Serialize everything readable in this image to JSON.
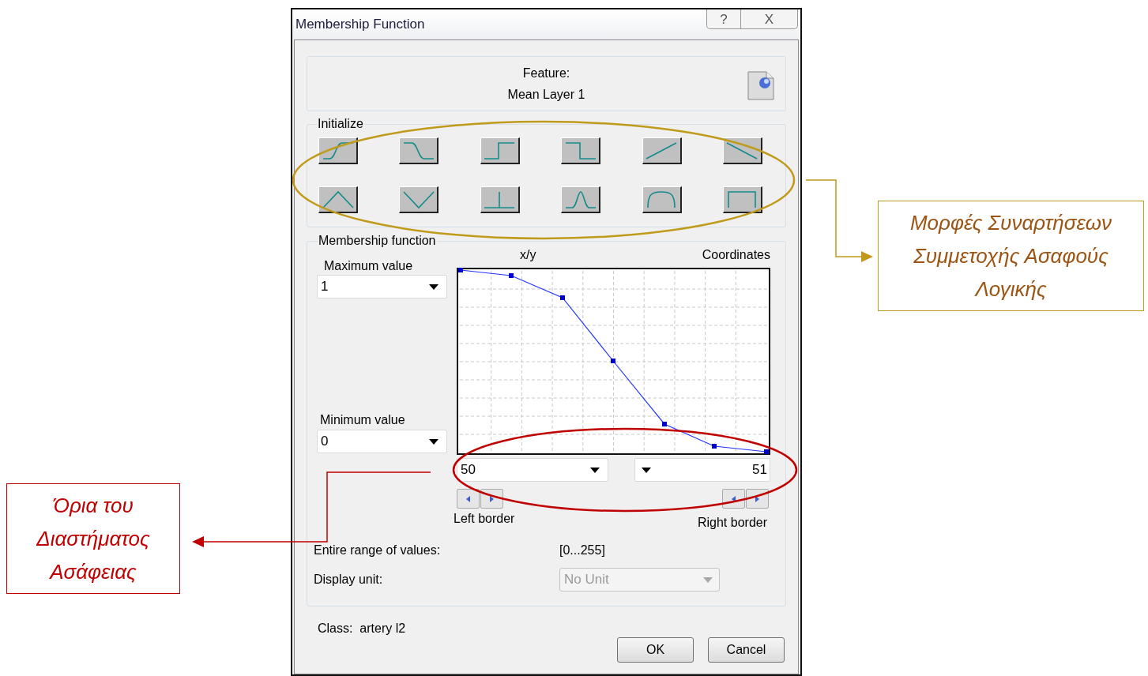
{
  "window": {
    "title": "Membership Function",
    "title_buttons": [
      "?",
      "X"
    ]
  },
  "feature": {
    "label": "Feature:",
    "value": "Mean Layer 1"
  },
  "initialize": {
    "label": "Initialize",
    "buttons": [
      {
        "kind": "s-rise"
      },
      {
        "kind": "s-fall"
      },
      {
        "kind": "step-up"
      },
      {
        "kind": "step-down"
      },
      {
        "kind": "linear-up"
      },
      {
        "kind": "linear-down"
      },
      {
        "kind": "triangle"
      },
      {
        "kind": "v-shape"
      },
      {
        "kind": "singleton"
      },
      {
        "kind": "gaussian"
      },
      {
        "kind": "rounded"
      },
      {
        "kind": "rectangle"
      }
    ]
  },
  "membership_function": {
    "label": "Membership function",
    "plot_heading": "x/y",
    "coordinates_label": "Coordinates",
    "maximum": {
      "label": "Maximum value",
      "value": "1"
    },
    "minimum": {
      "label": "Minimum value",
      "value": "0"
    },
    "left_border": {
      "label": "Left border",
      "value": "50"
    },
    "right_border": {
      "label": "Right border",
      "value": "51"
    },
    "range": {
      "label": "Entire range of values:",
      "value": "[0...255]"
    },
    "display_unit": {
      "label": "Display unit:",
      "value": "No Unit",
      "disabled": true
    }
  },
  "class_label": "Class:  artery l2",
  "buttons": [
    "OK",
    "Cancel"
  ],
  "annotations": [
    {
      "text": "Μορφές Συναρτήσεων Συμμετοχής Ασαφούς Λογικής",
      "color": "#c09a1a"
    },
    {
      "text": "Όρια του Διαστήματος Ασάφειας",
      "color": "#c00000"
    }
  ]
}
